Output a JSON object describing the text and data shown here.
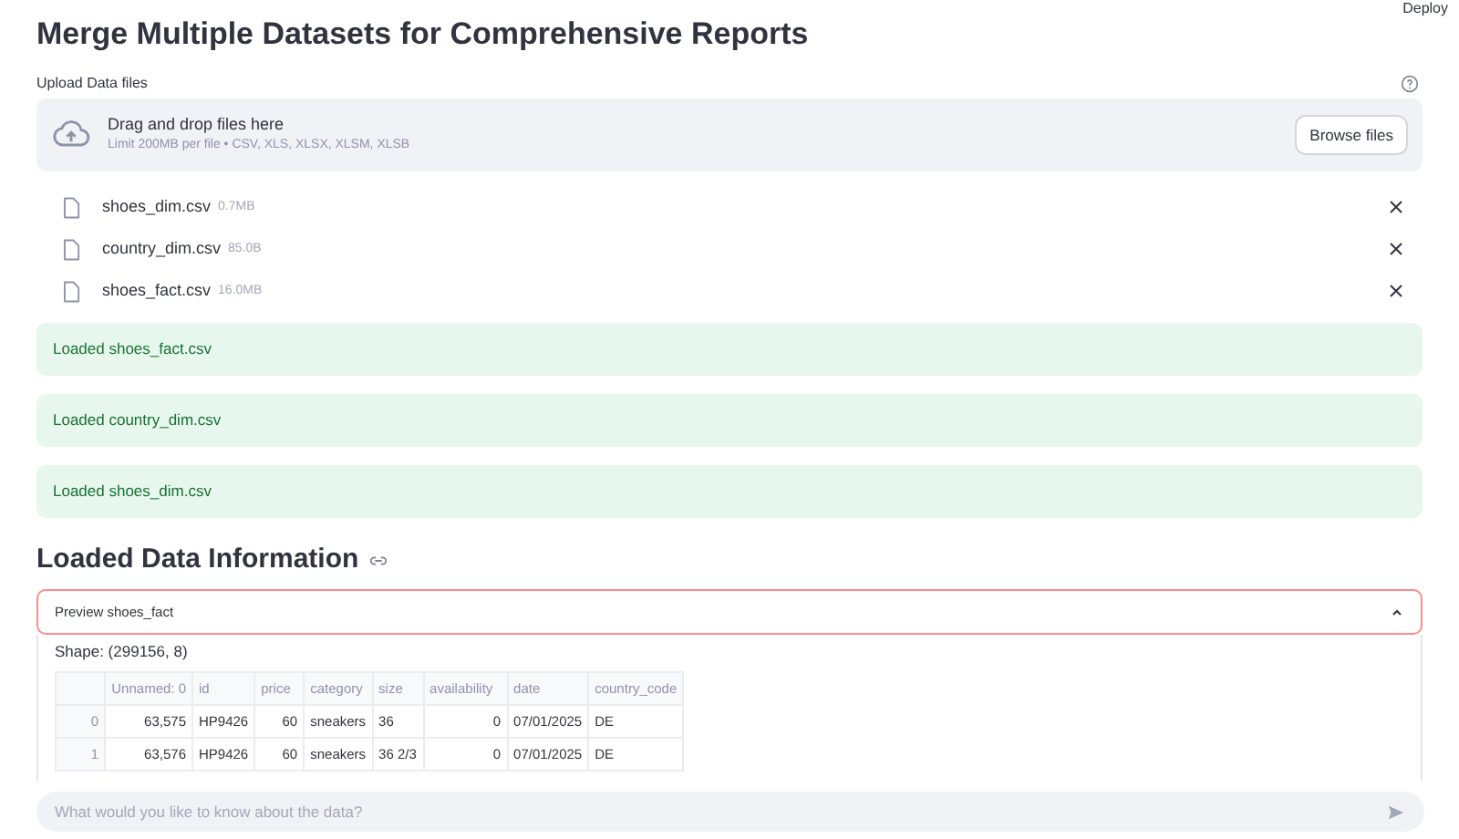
{
  "toolbar": {
    "deploy": "Deploy"
  },
  "title": "Merge Multiple Datasets for Comprehensive Reports",
  "uploader": {
    "label": "Upload Data files",
    "drop_text": "Drag and drop files here",
    "limit_text": "Limit 200MB per file • CSV, XLS, XLSX, XLSM, XLSB",
    "button": "Browse files",
    "files": [
      {
        "name": "shoes_dim.csv",
        "size": "0.7MB"
      },
      {
        "name": "country_dim.csv",
        "size": "85.0B"
      },
      {
        "name": "shoes_fact.csv",
        "size": "16.0MB"
      }
    ]
  },
  "alerts": [
    "Loaded shoes_fact.csv",
    "Loaded country_dim.csv",
    "Loaded shoes_dim.csv"
  ],
  "section_heading": "Loaded Data Information",
  "expander": {
    "label": "Preview shoes_fact",
    "expanded": true,
    "shape": "Shape: (299156, 8)",
    "table": {
      "columns": [
        "",
        "Unnamed: 0",
        "id",
        "price",
        "category",
        "size",
        "availability",
        "date",
        "country_code"
      ],
      "rows": [
        [
          "0",
          "63,575",
          "HP9426",
          "60",
          "sneakers",
          "36",
          "0",
          "07/01/2025",
          "DE"
        ],
        [
          "1",
          "63,576",
          "HP9426",
          "60",
          "sneakers",
          "36 2/3",
          "0",
          "07/01/2025",
          "DE"
        ]
      ]
    }
  },
  "chat_input": {
    "placeholder": "What would you like to know about the data?"
  }
}
